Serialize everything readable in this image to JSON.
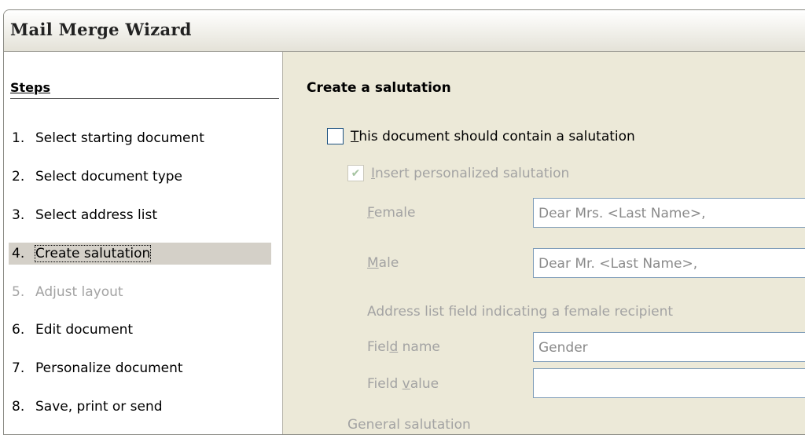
{
  "window": {
    "title": "Mail Merge Wizard"
  },
  "steps": {
    "header": "Steps",
    "items": [
      {
        "num": "1.",
        "label": "Select starting document",
        "state": "normal"
      },
      {
        "num": "2.",
        "label": "Select document type",
        "state": "normal"
      },
      {
        "num": "3.",
        "label": "Select address list",
        "state": "normal"
      },
      {
        "num": "4.",
        "label": "Create salutation",
        "state": "active"
      },
      {
        "num": "5.",
        "label": "Adjust layout",
        "state": "disabled"
      },
      {
        "num": "6.",
        "label": "Edit document",
        "state": "normal"
      },
      {
        "num": "7.",
        "label": "Personalize document",
        "state": "normal"
      },
      {
        "num": "8.",
        "label": "Save, print or send",
        "state": "normal"
      }
    ]
  },
  "content": {
    "title": "Create a salutation",
    "contain_salutation": {
      "accel": "T",
      "rest": "his document should contain a salutation",
      "checked": false
    },
    "insert_personalized": {
      "accel": "I",
      "rest": "nsert personalized salutation",
      "checked": true
    },
    "female": {
      "accel": "F",
      "rest": "emale",
      "value": "Dear Mrs. <Last Name>,"
    },
    "male": {
      "accel": "M",
      "rest": "ale",
      "value": "Dear Mr. <Last Name>,"
    },
    "address_field_caption": "Address list field indicating a female recipient",
    "field_name": {
      "pre": "Fiel",
      "accel": "d",
      "post": " name",
      "value": "Gender"
    },
    "field_value": {
      "pre": "Field ",
      "accel": "v",
      "post": "alue",
      "value": ""
    },
    "general_salutation_caption": "General salutation"
  }
}
